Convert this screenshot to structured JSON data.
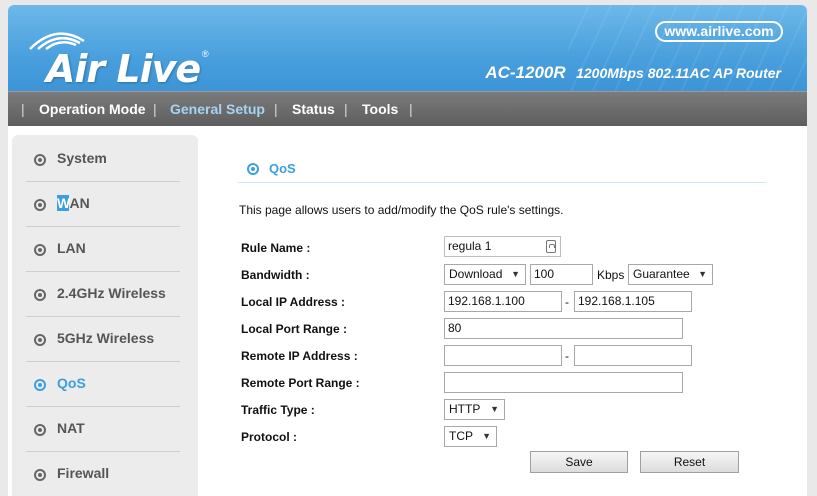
{
  "header": {
    "logo": "Air Live",
    "website": "www.airlive.com",
    "model_name": "AC-1200R",
    "model_desc": "1200Mbps 802.11AC AP Router"
  },
  "nav": {
    "items": [
      "Operation Mode",
      "General Setup",
      "Status",
      "Tools"
    ],
    "active": "General Setup"
  },
  "sidebar": {
    "items": [
      {
        "label": "System"
      },
      {
        "label_pre": "W",
        "label_post": "AN"
      },
      {
        "label": "LAN"
      },
      {
        "label": "2.4GHz Wireless"
      },
      {
        "label": "5GHz Wireless"
      },
      {
        "label": "QoS"
      },
      {
        "label": "NAT"
      },
      {
        "label": "Firewall"
      }
    ],
    "active": "QoS"
  },
  "main": {
    "section_title": "QoS",
    "intro": "This page allows users to add/modify the QoS rule's settings.",
    "labels": {
      "rule_name": "Rule Name :",
      "bandwidth": "Bandwidth :",
      "local_ip": "Local IP Address :",
      "local_port": "Local Port Range :",
      "remote_ip": "Remote IP Address :",
      "remote_port": "Remote Port Range :",
      "traffic_type": "Traffic Type :",
      "protocol": "Protocol :"
    },
    "values": {
      "rule_name": "regula 1",
      "bandwidth_direction": "Download",
      "bandwidth_value": "100",
      "bandwidth_unit": "Kbps",
      "bandwidth_mode": "Guarantee",
      "local_ip_start": "192.168.1.100",
      "local_ip_end": "192.168.1.105",
      "local_port": "80",
      "remote_ip_start": "",
      "remote_ip_end": "",
      "remote_port": "",
      "traffic_type": "HTTP",
      "protocol": "TCP"
    },
    "range_separator": "-",
    "buttons": {
      "save": "Save",
      "reset": "Reset"
    }
  },
  "colors": {
    "accent": "#3b9fe0",
    "header_blue": "#4aa0dd",
    "nav_gray": "#666666"
  }
}
